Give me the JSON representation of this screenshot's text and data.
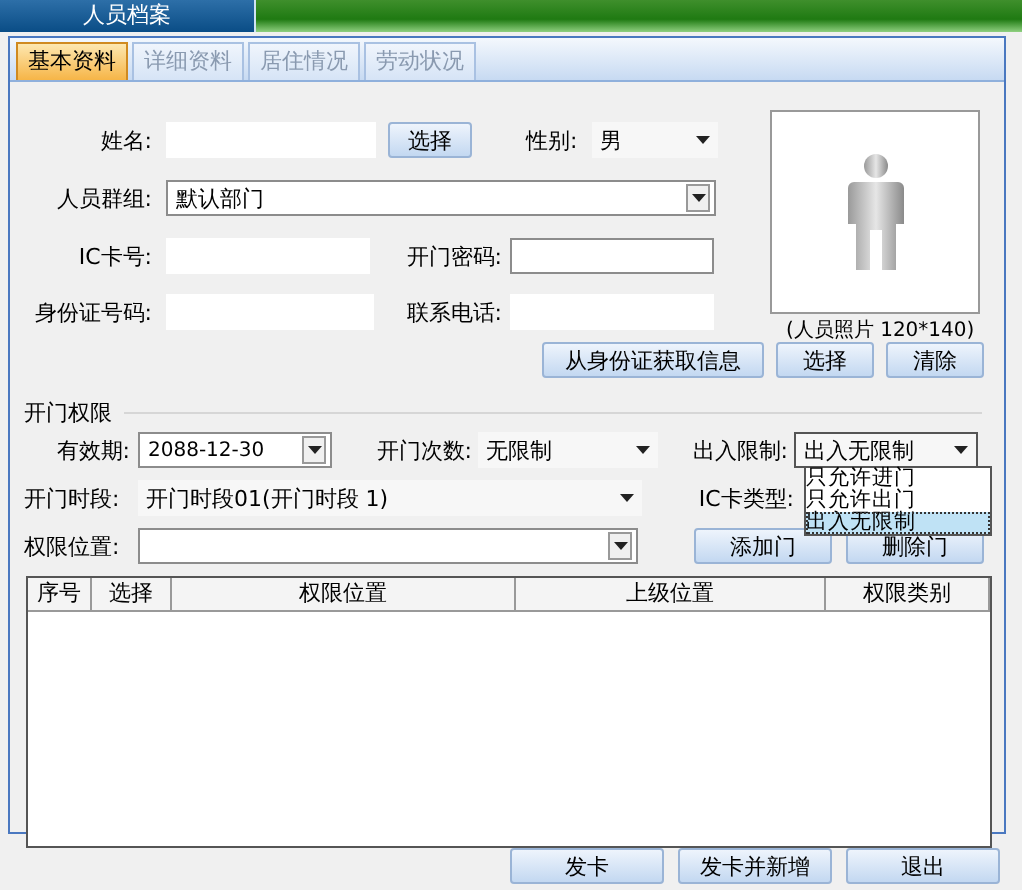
{
  "header": {
    "title": "人员档案"
  },
  "tabs": [
    {
      "label": "基本资料",
      "selected": true
    },
    {
      "label": "详细资料",
      "selected": false
    },
    {
      "label": "居住情况",
      "selected": false
    },
    {
      "label": "劳动状况",
      "selected": false
    }
  ],
  "name": {
    "label": "姓名:",
    "button": "选择"
  },
  "gender": {
    "label": "性别:",
    "value": "男"
  },
  "group": {
    "label": "人员群组:",
    "value": "默认部门"
  },
  "ic_card": {
    "label": "IC卡号:"
  },
  "password": {
    "label": "开门密码:"
  },
  "id_number": {
    "label": "身份证号码:"
  },
  "phone": {
    "label": "联系电话:"
  },
  "photo": {
    "caption": "(人员照片 120*140)"
  },
  "photo_buttons": [
    "从身份证获取信息",
    "选择",
    "清除"
  ],
  "access": {
    "title": "开门权限",
    "valid_until": {
      "label": "有效期:",
      "value": "2088-12-30"
    },
    "open_count": {
      "label": "开门次数:",
      "value": "无限制"
    },
    "in_out": {
      "label": "出入限制:",
      "value": "出入无限制",
      "expanded": true,
      "options": [
        {
          "label": "只允许进门",
          "selected": false
        },
        {
          "label": "只允许出门",
          "selected": false
        },
        {
          "label": "出入无限制",
          "selected": true
        }
      ]
    },
    "time_period": {
      "label": "开门时段:",
      "value": "开门时段01(开门时段 1)"
    },
    "ic_type": {
      "label": "IC卡类型:"
    },
    "location": {
      "label": "权限位置:"
    },
    "buttons": [
      "添加门",
      "删除门"
    ]
  },
  "table": {
    "columns": [
      "序号",
      "选择",
      "权限位置",
      "上级位置",
      "权限类别"
    ]
  },
  "footer_buttons": [
    "发卡",
    "发卡并新增",
    "退出"
  ]
}
